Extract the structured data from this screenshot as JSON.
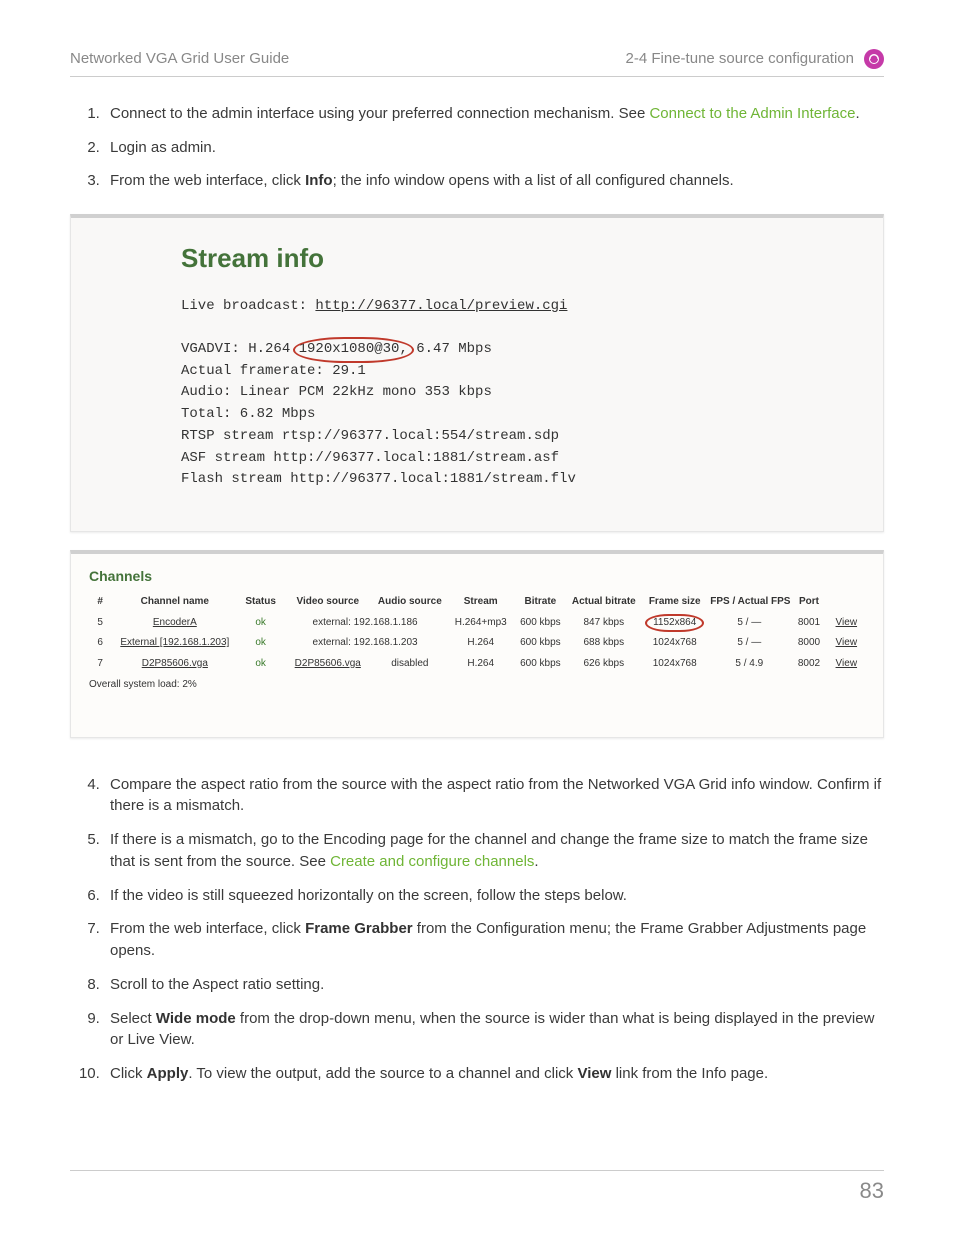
{
  "header": {
    "left": "Networked VGA Grid User Guide",
    "right": "2-4 Fine-tune source configuration"
  },
  "steps_a": [
    {
      "pre": "Connect to the admin interface using your preferred connection mechanism. See ",
      "link": "Connect to the Admin Interface",
      "post": "."
    },
    {
      "pre": "Login as admin."
    },
    {
      "pre": "From the web interface, click ",
      "bold": "Info",
      "post": "; the info window opens with a list of all configured channels."
    }
  ],
  "streambox": {
    "title": "Stream info",
    "live_label": "Live broadcast: ",
    "live_url": "http://96377.local/preview.cgi",
    "line_vga_pre": "VGADVI: H.264 ",
    "line_vga_mid": "1920x1080@30,",
    "line_vga_post": " 6.47 Mbps",
    "line_fr": "Actual framerate: 29.1",
    "line_audio": "Audio: Linear PCM 22kHz mono 353 kbps",
    "line_total": "Total: 6.82 Mbps",
    "line_rtsp": "RTSP stream rtsp://96377.local:554/stream.sdp",
    "line_asf": "ASF stream http://96377.local:1881/stream.asf",
    "line_flash": "Flash stream http://96377.local:1881/stream.flv"
  },
  "channels": {
    "heading": "Channels",
    "cols": [
      "#",
      "Channel name",
      "Status",
      "Video source",
      "Audio source",
      "Stream",
      "Bitrate",
      "Actual bitrate",
      "Frame size",
      "FPS / Actual FPS",
      "Port",
      ""
    ],
    "rows": [
      {
        "n": "5",
        "name": "EncoderA",
        "status": "ok",
        "vs": "external: 192.168.1.186",
        "as": "",
        "stream": "H.264+mp3",
        "br": "600 kbps",
        "abr": "847 kbps",
        "fs": "1152x864",
        "fps": "5 / —",
        "port": "8001",
        "view": "View",
        "circle": true,
        "vs_colspan": true
      },
      {
        "n": "6",
        "name": "External [192.168.1.203]",
        "status": "ok",
        "vs": "external: 192.168.1.203",
        "as": "",
        "stream": "H.264",
        "br": "600 kbps",
        "abr": "688 kbps",
        "fs": "1024x768",
        "fps": "5 / —",
        "port": "8000",
        "view": "View",
        "vs_colspan": true
      },
      {
        "n": "7",
        "name": "D2P85606.vga",
        "status": "ok",
        "vs": "D2P85606.vga",
        "as": "disabled",
        "stream": "H.264",
        "br": "600 kbps",
        "abr": "626 kbps",
        "fs": "1024x768",
        "fps": "5 / 4.9",
        "port": "8002",
        "view": "View"
      }
    ],
    "sysload": "Overall system load: 2%"
  },
  "steps_b": [
    {
      "pre": "Compare the aspect ratio from the source with the aspect ratio from the Networked VGA Grid info window. Confirm if there is a mismatch."
    },
    {
      "pre": "If there is a mismatch, go to the Encoding page for the channel and change the frame size to match the frame size that is sent from the source. See ",
      "link": "Create and configure channels",
      "post": "."
    },
    {
      "pre": "If the video is still squeezed horizontally on the screen, follow the steps below."
    },
    {
      "pre": "From the web interface, click ",
      "bold": "Frame Grabber",
      "post": " from the Configuration menu; the Frame Grabber Adjustments page opens."
    },
    {
      "pre": "Scroll to the Aspect ratio setting."
    },
    {
      "pre": "Select ",
      "bold": "Wide mode",
      "post": " from the drop-down menu, when the source is wider than what is being displayed in the preview or Live View."
    },
    {
      "pre": "Click ",
      "bold": "Apply",
      "post": ". To view the output, add the source to a channel and click ",
      "bold2": "View",
      "post2": " link from the Info page."
    }
  ],
  "page_number": "83"
}
